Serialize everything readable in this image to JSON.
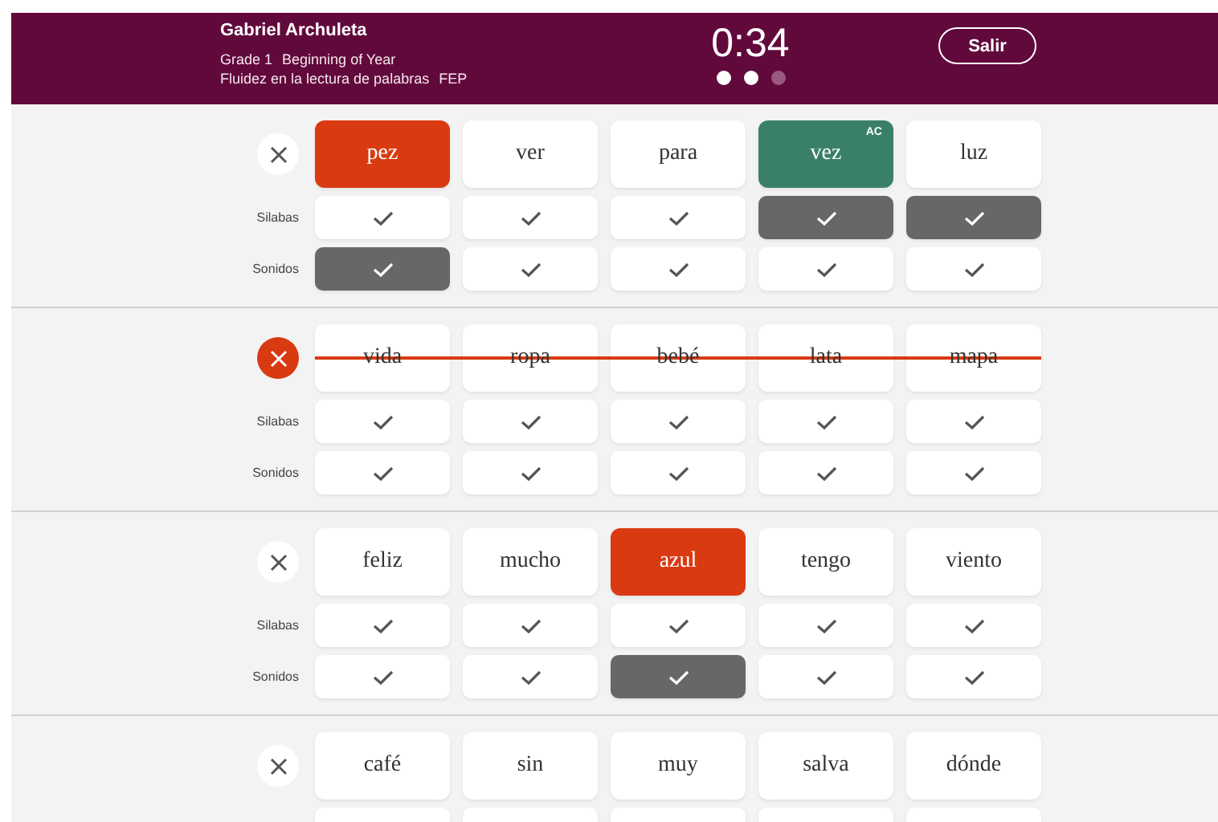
{
  "header": {
    "student": "Gabriel Archuleta",
    "grade": "Grade 1",
    "period": "Beginning of Year",
    "assessment": "Fluidez en la lectura de palabras",
    "code": "FEP",
    "timer": "0:34",
    "pages": [
      {
        "selected": true
      },
      {
        "selected": true
      },
      {
        "selected": false
      }
    ],
    "exit_button": "Salir"
  },
  "rows": [
    {
      "struck": false,
      "words": [
        {
          "text": "pez",
          "incorrect": true,
          "self_corrected": false
        },
        {
          "text": "ver",
          "incorrect": false,
          "self_corrected": false
        },
        {
          "text": "para",
          "incorrect": false,
          "self_corrected": false
        },
        {
          "text": "vez",
          "incorrect": false,
          "self_corrected": true,
          "badge": "AC"
        },
        {
          "text": "luz",
          "incorrect": false,
          "self_corrected": false
        }
      ],
      "checks": [
        {
          "label": "Silabas",
          "cells": [
            {
              "selected": false
            },
            {
              "selected": false
            },
            {
              "selected": false
            },
            {
              "selected": true
            },
            {
              "selected": true
            }
          ]
        },
        {
          "label": "Sonidos",
          "cells": [
            {
              "selected": true
            },
            {
              "selected": false
            },
            {
              "selected": false
            },
            {
              "selected": false
            },
            {
              "selected": false
            }
          ]
        }
      ]
    },
    {
      "struck": true,
      "words": [
        {
          "text": "vida",
          "incorrect": false,
          "self_corrected": false
        },
        {
          "text": "ropa",
          "incorrect": false,
          "self_corrected": false
        },
        {
          "text": "bebé",
          "incorrect": false,
          "self_corrected": false
        },
        {
          "text": "lata",
          "incorrect": false,
          "self_corrected": false
        },
        {
          "text": "mapa",
          "incorrect": false,
          "self_corrected": false
        }
      ],
      "checks": [
        {
          "label": "Silabas",
          "cells": [
            {
              "selected": false
            },
            {
              "selected": false
            },
            {
              "selected": false
            },
            {
              "selected": false
            },
            {
              "selected": false
            }
          ]
        },
        {
          "label": "Sonidos",
          "cells": [
            {
              "selected": false
            },
            {
              "selected": false
            },
            {
              "selected": false
            },
            {
              "selected": false
            },
            {
              "selected": false
            }
          ]
        }
      ]
    },
    {
      "struck": false,
      "words": [
        {
          "text": "feliz",
          "incorrect": false,
          "self_corrected": false
        },
        {
          "text": "mucho",
          "incorrect": false,
          "self_corrected": false
        },
        {
          "text": "azul",
          "incorrect": true,
          "self_corrected": false
        },
        {
          "text": "tengo",
          "incorrect": false,
          "self_corrected": false
        },
        {
          "text": "viento",
          "incorrect": false,
          "self_corrected": false
        }
      ],
      "checks": [
        {
          "label": "Silabas",
          "cells": [
            {
              "selected": false
            },
            {
              "selected": false
            },
            {
              "selected": false
            },
            {
              "selected": false
            },
            {
              "selected": false
            }
          ]
        },
        {
          "label": "Sonidos",
          "cells": [
            {
              "selected": false
            },
            {
              "selected": false
            },
            {
              "selected": true
            },
            {
              "selected": false
            },
            {
              "selected": false
            }
          ]
        }
      ]
    },
    {
      "struck": false,
      "words": [
        {
          "text": "café",
          "incorrect": false,
          "self_corrected": false
        },
        {
          "text": "sin",
          "incorrect": false,
          "self_corrected": false
        },
        {
          "text": "muy",
          "incorrect": false,
          "self_corrected": false
        },
        {
          "text": "salva",
          "incorrect": false,
          "self_corrected": false
        },
        {
          "text": "dónde",
          "incorrect": false,
          "self_corrected": false
        }
      ],
      "checks": [
        {
          "cells": [
            {
              "selected": false
            },
            {
              "selected": false
            },
            {
              "selected": false
            },
            {
              "selected": false
            },
            {
              "selected": false
            }
          ]
        }
      ]
    }
  ]
}
